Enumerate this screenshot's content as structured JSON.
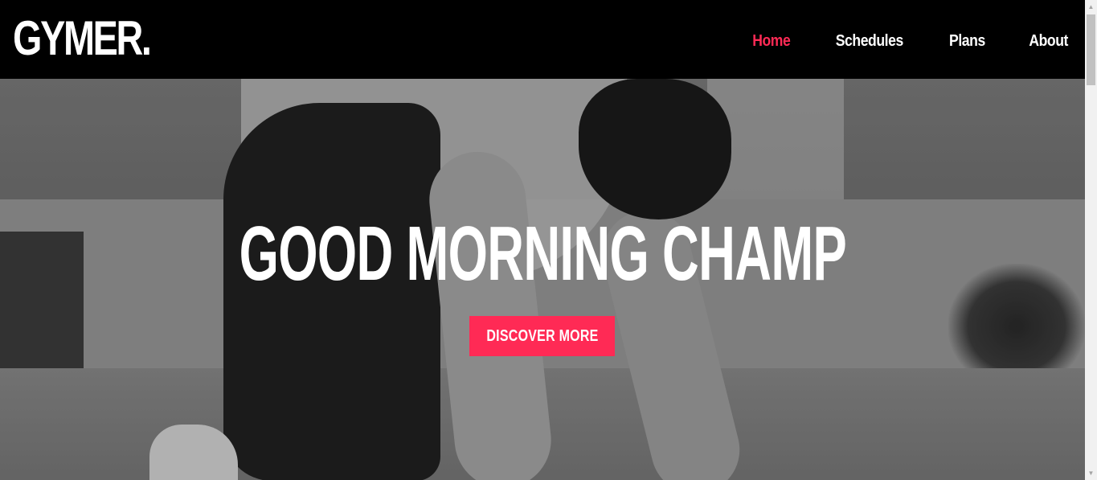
{
  "brand": {
    "logo": "GYMER."
  },
  "nav": {
    "items": [
      {
        "label": "Home",
        "active": true
      },
      {
        "label": "Schedules",
        "active": false
      },
      {
        "label": "Plans",
        "active": false
      },
      {
        "label": "About",
        "active": false
      }
    ]
  },
  "hero": {
    "title": "GOOD MORNING CHAMP",
    "cta_label": "DISCOVER MORE"
  },
  "colors": {
    "accent": "#ff2a55",
    "header_bg": "#000000",
    "text": "#ffffff"
  },
  "icons": {
    "scroll_up": "arrow-up-icon",
    "scroll_down": "arrow-down-icon"
  }
}
